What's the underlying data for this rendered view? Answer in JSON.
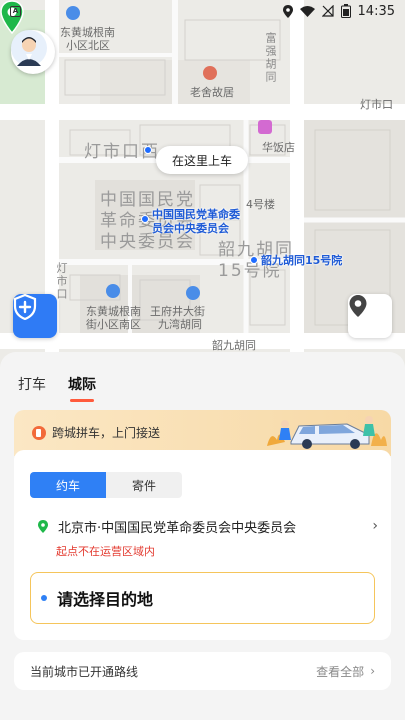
{
  "status_bar": {
    "time": "14:35",
    "left_icon": "a-app-icon",
    "right_icons": [
      "location-icon",
      "wifi-icon",
      "sim-off-icon",
      "battery-icon"
    ]
  },
  "map": {
    "labels": {
      "dongcheng_north": "东黄城根南",
      "dongcheng_north2": "小区北区",
      "laoshe": "老舍故居",
      "fuqiang": "富强胡同",
      "dengshikou_road": "灯市口",
      "huashi": "华饭店",
      "dengshi_w": "灯市口西",
      "cpc_big": "中国国民党\n革命委员会\n中央委员会",
      "building4": "4号楼",
      "shaojiu": "韶九胡同\n15号院",
      "dongcheng_south": "东黄城根南",
      "dongcheng_south2": "街小区南区",
      "wangfujing": "王府井大街",
      "jiuwan": "九湾胡同",
      "dengshikou_station": "灯市口",
      "shaojiu_road": "韶九胡同"
    },
    "pickup_bubble": "在这里上车",
    "poi_cpc": "中国国民党革命委\n员会中央委员会",
    "poi_shaojiu": "韶九胡同15号院"
  },
  "sheet": {
    "tabs": [
      "打车",
      "城际"
    ],
    "active_tab": 1,
    "promo": "跨城拼车，上门接送",
    "segments": [
      "约车",
      "寄件"
    ],
    "active_segment": 0,
    "origin": "北京市·中国国民党革命委员会中央委员会",
    "origin_warning": "起点不在运营区域内",
    "destination_placeholder": "请选择目的地",
    "routes_title": "当前城市已开通路线",
    "routes_more": "查看全部"
  },
  "colors": {
    "accent_blue": "#2f80f5",
    "tab_underline": "#ff5a3c",
    "warning_red": "#e33a2f",
    "pin_green": "#1fb84a",
    "dest_border": "#f5c55b"
  }
}
